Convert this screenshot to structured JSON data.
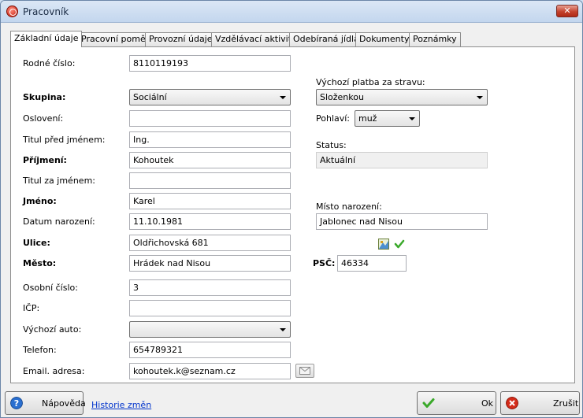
{
  "window": {
    "title": "Pracovník"
  },
  "tabs": [
    "Základní údaje",
    "Pracovní poměr",
    "Provozní údaje",
    "Vzdělávací aktivity",
    "Odebíraná jídla",
    "Dokumenty",
    "Poznámky"
  ],
  "form": {
    "rodne_cislo": {
      "label": "Rodné číslo:",
      "value": "8110119193"
    },
    "skupina": {
      "label": "Skupina:",
      "value": "Sociální"
    },
    "osloveni": {
      "label": "Oslovení:",
      "value": ""
    },
    "titul_pred": {
      "label": "Titul před jménem:",
      "value": "Ing."
    },
    "prijmeni": {
      "label": "Příjmení:",
      "value": "Kohoutek"
    },
    "titul_za": {
      "label": "Titul za jménem:",
      "value": ""
    },
    "jmeno": {
      "label": "Jméno:",
      "value": "Karel"
    },
    "datum_narozeni": {
      "label": "Datum narození:",
      "value": "11.10.1981"
    },
    "ulice": {
      "label": "Ulice:",
      "value": "Oldřichovská 681"
    },
    "mesto": {
      "label": "Město:",
      "value": "Hrádek nad Nisou"
    },
    "osobni_cislo": {
      "label": "Osobní číslo:",
      "value": "3"
    },
    "icp": {
      "label": "IČP:",
      "value": ""
    },
    "vychozi_auto": {
      "label": "Výchozí auto:",
      "value": ""
    },
    "telefon": {
      "label": "Telefon:",
      "value": "654789321"
    },
    "email": {
      "label": "Email. adresa:",
      "value": "kohoutek.k@seznam.cz"
    },
    "platba": {
      "label": "Výchozí platba za stravu:",
      "value": "Složenkou"
    },
    "pohlavi": {
      "label": "Pohlaví:",
      "value": "muž"
    },
    "status": {
      "label": "Status:",
      "value": "Aktuální"
    },
    "misto_narozeni": {
      "label": "Místo narození:",
      "value": "Jablonec nad Nisou"
    },
    "psc": {
      "label": "PSČ:",
      "value": "46334"
    }
  },
  "footer": {
    "help_label": "Nápověda",
    "history_link": "Historie změn",
    "ok_label": "Ok",
    "cancel_label": "Zrušit"
  },
  "colors": {
    "link": "#0033cc",
    "ok_green": "#3aa92a",
    "cancel_red": "#d42c1a",
    "help_blue": "#2a6fd0"
  }
}
